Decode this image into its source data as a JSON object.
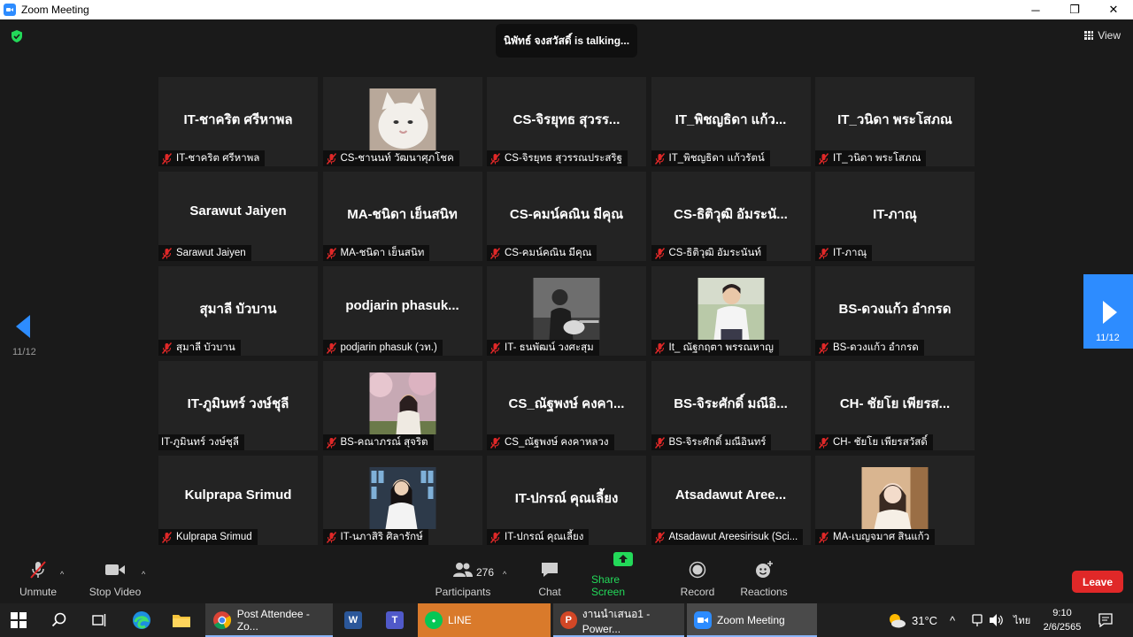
{
  "window": {
    "title": "Zoom Meeting",
    "controls": [
      "─",
      "❐",
      "✕"
    ]
  },
  "meeting": {
    "talking_indicator": "นิพัทธ์ จงสวัสดิ์ is talking...",
    "view_label": "View",
    "page_left": "11/12",
    "page_right": "11/12",
    "tiles": [
      {
        "big": "IT-ชาคริต ศรีหาพล",
        "label": "IT-ชาคริต ศรีหาพล",
        "muted": true,
        "photo": null
      },
      {
        "big": "",
        "label": "CS-ชานนท์ วัฒนาศุภโชค",
        "muted": true,
        "photo": "cat"
      },
      {
        "big": "CS-จิรยุทธ สุวรร...",
        "label": "CS-จิรยุทธ สุวรรณประสริฐ",
        "muted": true,
        "photo": null
      },
      {
        "big": "IT_พิชญธิดา แก้ว...",
        "label": "IT_พิชญธิดา แก้วรัตน์",
        "muted": true,
        "photo": null
      },
      {
        "big": "IT_วนิดา พระโสภณ",
        "label": "IT_วนิดา พระโสภณ",
        "muted": true,
        "photo": null
      },
      {
        "big": "Sarawut Jaiyen",
        "label": "Sarawut Jaiyen",
        "muted": true,
        "photo": null
      },
      {
        "big": "MA-ชนิดา เย็นสนิท",
        "label": "MA-ชนิดา เย็นสนิท",
        "muted": true,
        "photo": null
      },
      {
        "big": "CS-คมน์คณิน มีคุณ",
        "label": "CS-คมน์คณิน มีคุณ",
        "muted": true,
        "photo": null
      },
      {
        "big": "CS-ธิติวุฒิ อัมระนั...",
        "label": "CS-ธิติวุฒิ อัมระนันท์",
        "muted": true,
        "photo": null
      },
      {
        "big": "IT-ภาณุ",
        "label": "IT-ภาณุ",
        "muted": true,
        "photo": null
      },
      {
        "big": "สุมาลี บัวบาน",
        "label": "สุมาลี บัวบาน",
        "muted": true,
        "photo": null
      },
      {
        "big": "podjarin  phasuk...",
        "label": "podjarin phasuk (วท.)",
        "muted": true,
        "photo": null
      },
      {
        "big": "",
        "label": "IT- ธนพัฒน์ วงศะสุม",
        "muted": true,
        "photo": "guitar"
      },
      {
        "big": "",
        "label": "It_ ณัฐกฤตา พรรณหาญ",
        "muted": true,
        "photo": "student"
      },
      {
        "big": "BS-ดวงแก้ว อำกรด",
        "label": "BS-ดวงแก้ว อำกรด",
        "muted": true,
        "photo": null
      },
      {
        "big": "IT-ภูมินทร์ วงษ์ชุลี",
        "label": "IT-ภูมินทร์ วงษ์ชุลี",
        "muted": false,
        "photo": null
      },
      {
        "big": "",
        "label": "BS-คณาภรณ์ สุจริต",
        "muted": true,
        "photo": "blossom"
      },
      {
        "big": "CS_ณัฐพงษ์ คงคา...",
        "label": "CS_ณัฐพงษ์ คงคาหลวง",
        "muted": true,
        "photo": null
      },
      {
        "big": "BS-จิระศักดิ์ มณีอิ...",
        "label": "BS-จิระศักดิ์ มณีอินทร์",
        "muted": true,
        "photo": null
      },
      {
        "big": "CH- ชัยโย เพียรส...",
        "label": "CH- ชัยโย เพียรสวัสดิ์",
        "muted": true,
        "photo": null
      },
      {
        "big": "Kulprapa Srimud",
        "label": "Kulprapa Srimud",
        "muted": true,
        "photo": null
      },
      {
        "big": "",
        "label": "IT-นภาสิริ ศิลารักษ์",
        "muted": true,
        "photo": "girl"
      },
      {
        "big": "IT-ปกรณ์ คุณเลี้ยง",
        "label": "IT-ปกรณ์ คุณเลี้ยง",
        "muted": true,
        "photo": null
      },
      {
        "big": "Atsadawut  Aree...",
        "label": "Atsadawut Areesirisuk (Sci...",
        "muted": true,
        "photo": null
      },
      {
        "big": "",
        "label": "MA-เบญจมาศ สินแก้ว",
        "muted": true,
        "photo": "portrait"
      }
    ]
  },
  "toolbar": {
    "unmute": "Unmute",
    "stop_video": "Stop Video",
    "participants": "Participants",
    "participants_count": "276",
    "chat": "Chat",
    "share_screen": "Share Screen",
    "record": "Record",
    "reactions": "Reactions",
    "leave": "Leave"
  },
  "taskbar": {
    "apps": [
      {
        "label": "Post Attendee - Zo...",
        "icon": "chrome-icon",
        "color": "#3a3a3a"
      },
      {
        "label": "LINE",
        "icon": "line-icon",
        "color": "#d97a2b"
      },
      {
        "label": "งานนำเสนอ1 - Power...",
        "icon": "powerpoint-icon",
        "color": "#3a3a3a"
      },
      {
        "label": "Zoom Meeting",
        "icon": "zoom-icon",
        "color": "#4a4a4a"
      }
    ],
    "temperature": "31°C",
    "language": "ไทย",
    "time": "9:10",
    "date": "2/6/2565"
  },
  "colors": {
    "accent": "#2d8cff",
    "share": "#23d959",
    "leave": "#e02828",
    "muted_mic": "#e02828"
  }
}
